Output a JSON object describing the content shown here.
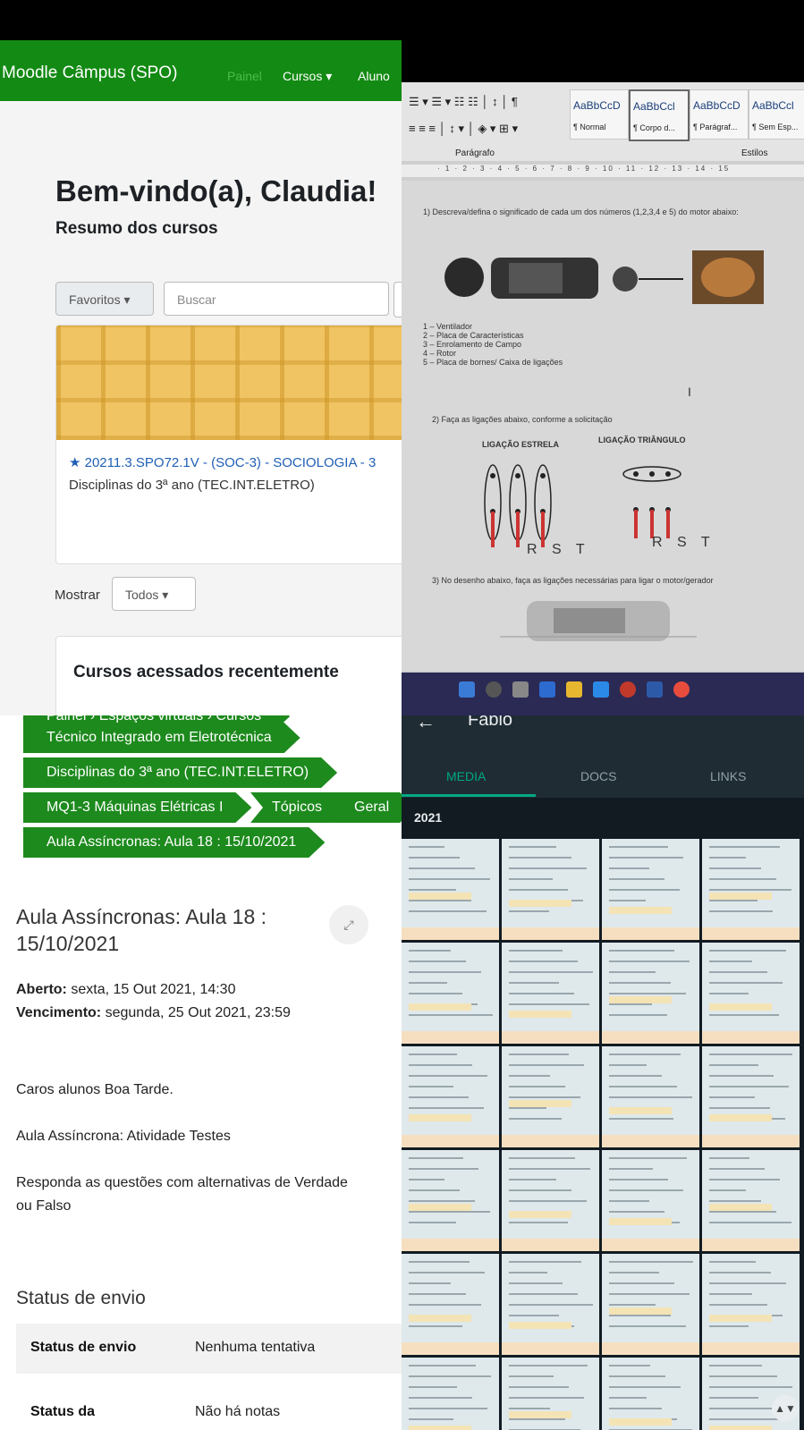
{
  "moodle_dashboard": {
    "brand": "Moodle Câmpus (SPO)",
    "nav": [
      "Painel",
      "Cursos ▾",
      "Aluno"
    ],
    "welcome": "Bem-vindo(a), Claudia!",
    "summary_title": "Resumo dos cursos",
    "filter_label": "Favoritos ▾",
    "search_placeholder": "Buscar",
    "course_name": "★ 20211.3.SPO72.1V - (SOC-3) - SOCIOLOGIA - 3",
    "course_category": "Disciplinas do 3ª ano (TEC.INT.ELETRO)",
    "show_label": "Mostrar",
    "show_value": "Todos ▾",
    "recent_title": "Cursos acessados recentemente"
  },
  "word_doc": {
    "styles": [
      {
        "preview": "AaBbCcD",
        "name": "¶ Normal"
      },
      {
        "preview": "AaBbCcl",
        "name": "¶ Corpo d..."
      },
      {
        "preview": "AaBbCcD",
        "name": "¶ Parágraf..."
      },
      {
        "preview": "AaBbCcl",
        "name": "¶ Sem Esp..."
      }
    ],
    "group_paragraph": "Parágrafo",
    "group_styles": "Estilos",
    "ruler": "· 1 · 2 · 3 · 4 · 5 · 6 · 7 · 8 · 9 · 10 · 11 · 12 · 13 · 14 · 15",
    "q1": "1) Descreva/defina o significado de cada um dos números (1,2,3,4 e 5) do motor abaixo:",
    "legend": [
      "1 – Ventilador",
      "2 – Placa de Características",
      "3 – Enrolamento de Campo",
      "4 – Rotor",
      "5 – Placa de bornes/ Caixa de ligações"
    ],
    "q2": "2) Faça as ligações abaixo, conforme a solicitação",
    "star_label": "LIGAÇÃO ESTRELA",
    "delta_label": "LIGAÇÃO TRIÂNGULO",
    "phases_star": "R S T",
    "phases_delta": "R S T",
    "q3": "3) No desenho abaixo, faça as ligações necessárias para ligar o motor/gerador"
  },
  "assignment": {
    "breadcrumbs": [
      "Painel",
      "Espaços virtuais",
      "Cursos"
    ],
    "crumb_course1": "Técnico Integrado em Eletrotécnica",
    "crumb_course2": "Disciplinas do 3ª ano (TEC.INT.ELETRO)",
    "crumb_subject": "MQ1-3 Máquinas Elétricas I",
    "crumb_topics": "Tópicos",
    "crumb_general": "Geral",
    "crumb_lesson": "Aula Assíncronas: Aula 18 : 15/10/2021",
    "title": "Aula Assíncronas: Aula 18 : 15/10/2021",
    "opened_label": "Aberto:",
    "opened_value": "sexta, 15 Out 2021, 14:30",
    "due_label": "Vencimento:",
    "due_value": "segunda, 25 Out 2021, 23:59",
    "greeting": "Caros alunos Boa Tarde.",
    "activity": "Aula Assíncrona: Atividade Testes",
    "instruction_line1": "Responda as questões com alternativas  de Verdade",
    "instruction_line2": "ou Falso",
    "status_heading": "Status de envio",
    "status_rows": [
      {
        "label": "Status de envio",
        "value": "Nenhuma tentativa"
      },
      {
        "label": "Status da",
        "value": "Não há notas"
      }
    ]
  },
  "whatsapp": {
    "contact": "Fabio",
    "tabs": [
      "MEDIA",
      "DOCS",
      "LINKS"
    ],
    "active_tab": "MEDIA",
    "year": "2021",
    "colors": {
      "accent": "#00a884",
      "header": "#1f2c33",
      "moodle_green": "#138a13"
    }
  }
}
